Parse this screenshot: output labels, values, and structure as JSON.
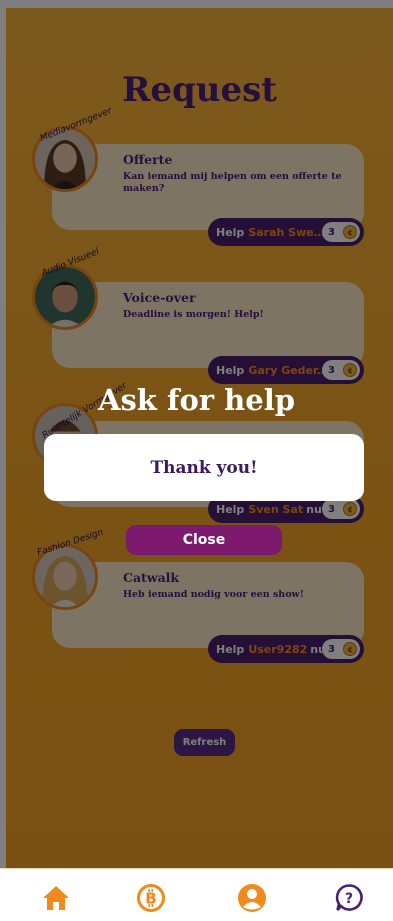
{
  "page": {
    "title": "Request"
  },
  "requests": [
    {
      "category": "Mediavormgever",
      "title": "Offerte",
      "description": "Kan iemand mij helpen om een offerte te maken?",
      "help_label": "Help",
      "user": "Sarah Swen...",
      "suffix": "",
      "coins": "3"
    },
    {
      "category": "Audio Visueel",
      "title": "Voice-over",
      "description": "Deadline is morgen! Help!",
      "help_label": "Help",
      "user": "Gary Geder...",
      "suffix": "",
      "coins": "3"
    },
    {
      "category": "Ruimtelijk Vormgever",
      "title": "",
      "description": "",
      "help_label": "Help",
      "user": "Sven Sat",
      "suffix": "nu!",
      "coins": "3"
    },
    {
      "category": "Fashion Design",
      "title": "Catwalk",
      "description": "Heb iemand nodig voor een show!",
      "help_label": "Help",
      "user": "User9282",
      "suffix": "nu!",
      "coins": "3"
    }
  ],
  "refresh_label": "Refresh",
  "modal": {
    "title": "Ask for help",
    "message": "Thank you!",
    "close_label": "Close"
  },
  "nav": {
    "items": [
      {
        "icon": "home-icon"
      },
      {
        "icon": "bitcoin-icon"
      },
      {
        "icon": "user-icon"
      },
      {
        "icon": "help-icon"
      }
    ]
  },
  "colors": {
    "accent": "#f08a1c",
    "primary": "#4a1f7a",
    "close_button": "#7d1a6e",
    "background": "#f9b33b"
  }
}
